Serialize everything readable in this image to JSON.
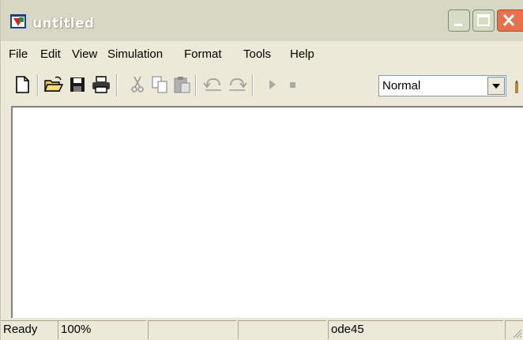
{
  "window": {
    "title": "untitled",
    "controls": {
      "minimize_icon": "minimize-icon",
      "maximize_icon": "maximize-icon",
      "close_icon": "close-icon"
    }
  },
  "menubar": {
    "items": [
      {
        "label": "File"
      },
      {
        "label": "Edit"
      },
      {
        "label": "View"
      },
      {
        "label": "Simulation"
      },
      {
        "label": "Format"
      },
      {
        "label": "Tools"
      },
      {
        "label": "Help"
      }
    ]
  },
  "toolbar": {
    "buttons": [
      "new-icon",
      "open-icon",
      "save-icon",
      "print-icon",
      "cut-icon",
      "copy-icon",
      "paste-icon",
      "undo-icon",
      "redo-icon",
      "start-simulation-icon",
      "stop-simulation-icon"
    ],
    "simulation_mode": "Normal"
  },
  "statusbar": {
    "status": "Ready",
    "zoom": "100%",
    "cell3": "",
    "cell4": "",
    "solver": "ode45",
    "cell6": ""
  },
  "colors": {
    "titlebar": "#d7d7c3",
    "close_button": "#e8704c",
    "canvas": "#ffffff",
    "chrome": "#ece9d8"
  }
}
